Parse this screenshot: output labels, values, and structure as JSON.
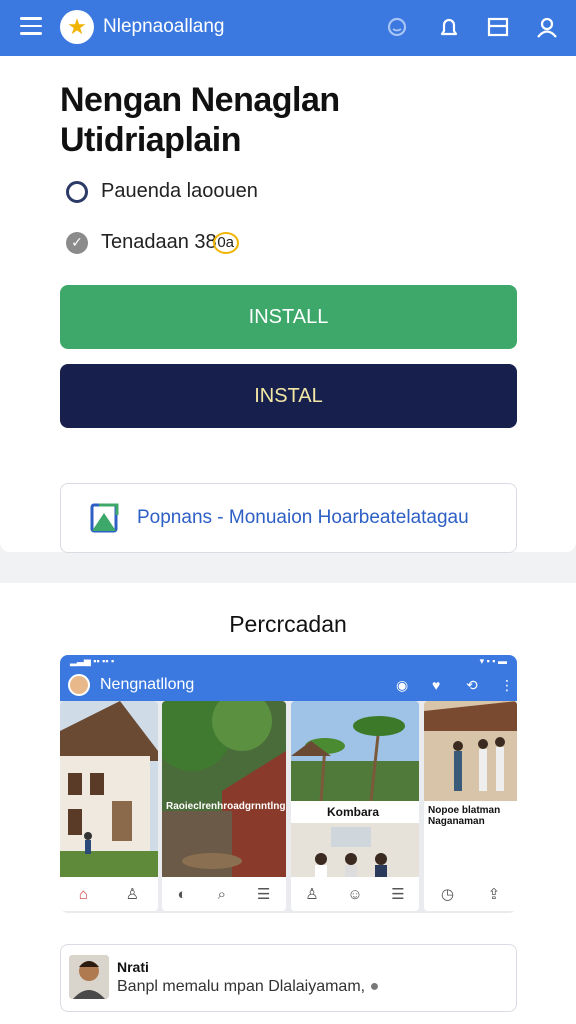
{
  "topbar": {
    "title": "Nlepnaoallang",
    "icons": [
      "menu-icon",
      "star-icon",
      "chat-icon",
      "bell-icon",
      "window-icon",
      "user-icon"
    ]
  },
  "main": {
    "headline_line1": "Nengan Nenaglan",
    "headline_line2": "Utidriaplain",
    "option1": "Pauenda laoouen",
    "option2": "Tenadaan 38",
    "option2_badge": "0a",
    "install_primary": "INSTALL",
    "install_secondary": "INSTAL",
    "link_text": "Popnans - Monuaion Hoarbeatelatagau"
  },
  "preview": {
    "title": "Percrcadan",
    "app_title": "Nengnatllong",
    "tile2_caption": "Raoieclrenhroadgrnntlng",
    "tile3_caption": "Kombara",
    "tile4_caption": "Nopoe blatman Naganaman"
  },
  "comment": {
    "name": "Nrati",
    "text": "Banpl memalu mpan Dlalaiyamam,"
  },
  "colors": {
    "topbar": "#3b79e0",
    "install_primary": "#3ea86a",
    "install_secondary": "#17204d",
    "link": "#2d5fc4"
  }
}
